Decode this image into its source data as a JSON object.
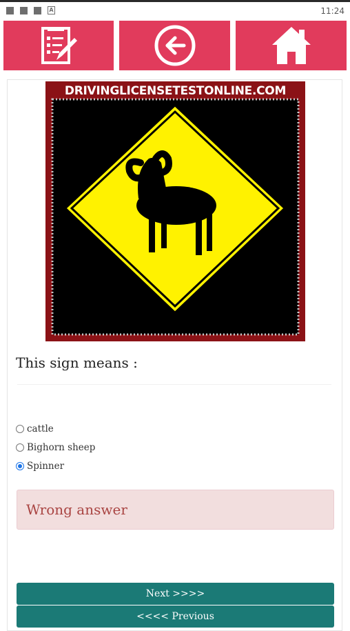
{
  "status_bar": {
    "time": "11:24"
  },
  "toolbar": {
    "buttons": [
      {
        "icon": "quiz-list-icon"
      },
      {
        "icon": "back-arrow-icon"
      },
      {
        "icon": "home-icon"
      }
    ],
    "accent": "#e13b5c"
  },
  "sign_image": {
    "watermark": "DRIVINGLICENSETESTONLINE.COM"
  },
  "question": {
    "text": "This sign means :"
  },
  "options": [
    {
      "label": "cattle",
      "checked": false
    },
    {
      "label": "Bighorn sheep",
      "checked": false
    },
    {
      "label": "Spinner",
      "checked": true
    }
  ],
  "result": {
    "text": "Wrong answer",
    "color": "#a94442"
  },
  "navigation": {
    "next_label": "Next >>>>",
    "previous_label": "<<<< Previous",
    "color": "#1b7a76"
  }
}
